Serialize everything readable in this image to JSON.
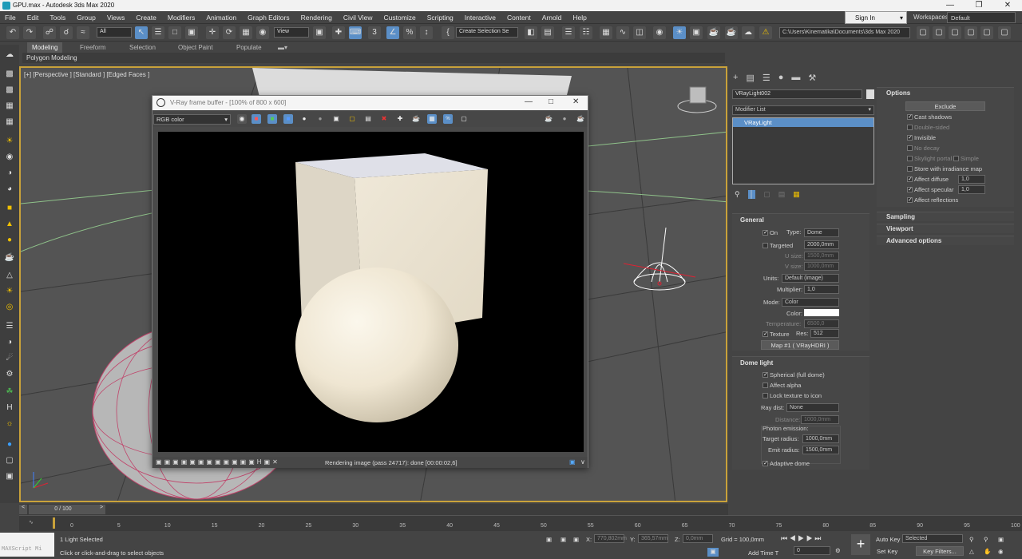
{
  "app": {
    "title": "GPU.max - Autodesk 3ds Max 2020"
  },
  "menu": [
    "File",
    "Edit",
    "Tools",
    "Group",
    "Views",
    "Create",
    "Modifiers",
    "Animation",
    "Graph Editors",
    "Rendering",
    "Civil View",
    "Customize",
    "Scripting",
    "Interactive",
    "Content",
    "Arnold",
    "Help"
  ],
  "account": {
    "signin": "Sign In",
    "workspaces_label": "Workspaces:",
    "workspace": "Default"
  },
  "toolbar": {
    "selection_filter": "All",
    "ref_coord": "View",
    "named_selection": "Create Selection Se",
    "project_path": "C:\\Users\\Kinematika\\Documents\\3ds Max 2020"
  },
  "ribbon": {
    "tabs": [
      "Modeling",
      "Freeform",
      "Selection",
      "Object Paint",
      "Populate"
    ],
    "sub": "Polygon Modeling"
  },
  "viewport": {
    "label": "[+] [Perspective ] [Standard ] [Edged Faces ]"
  },
  "vfb": {
    "title": "V-Ray frame buffer - [100% of 800 x 600]",
    "channel": "RGB color",
    "status": "Rendering image (pass 24717): done [00:00:02,6]"
  },
  "modify": {
    "object_name": "VRayLight002",
    "modifier_list": "Modifier List",
    "stack_item": "VRayLight",
    "general": {
      "title": "General",
      "on": "On",
      "type_label": "Type:",
      "type": "Dome",
      "targeted": "Targeted",
      "targeted_val": "2000,0mm",
      "usize_label": "U size:",
      "usize": "1500,0mm",
      "vsize_label": "V size:",
      "vsize": "1000,0mm",
      "units_label": "Units:",
      "units": "Default (image)",
      "multiplier_label": "Multiplier:",
      "multiplier": "1,0",
      "mode_label": "Mode:",
      "mode": "Color",
      "color_label": "Color:",
      "temperature_label": "Temperature:",
      "temperature": "6500,0",
      "texture": "Texture",
      "res_label": "Res:",
      "res": "512",
      "map": "Map #1 ( VRayHDRI )"
    },
    "dome": {
      "title": "Dome light",
      "spherical": "Spherical (full dome)",
      "affect_alpha": "Affect alpha",
      "lock": "Lock texture to icon",
      "raydist_label": "Ray dist:",
      "raydist": "None",
      "distance_label": "Distance:",
      "distance": "1000,0mm",
      "photon": "Photon emission:",
      "target_label": "Target radius:",
      "target": "1000,0mm",
      "emit_label": "Emit radius:",
      "emit": "1500,0mm",
      "adaptive": "Adaptive dome"
    },
    "options": {
      "title": "Options",
      "exclude": "Exclude",
      "cast_shadows": "Cast shadows",
      "double_sided": "Double-sided",
      "invisible": "Invisible",
      "no_decay": "No decay",
      "skylight": "Skylight portal",
      "simple": "Simple",
      "store": "Store with irradiance map",
      "affect_diffuse": "Affect diffuse",
      "affect_diffuse_val": "1,0",
      "affect_specular": "Affect specular",
      "affect_specular_val": "1,0",
      "affect_reflections": "Affect reflections"
    },
    "rollouts": [
      "Sampling",
      "Viewport",
      "Advanced options"
    ]
  },
  "timeline": {
    "frame": "0 / 100",
    "ticks": [
      "0",
      "5",
      "10",
      "15",
      "20",
      "25",
      "30",
      "35",
      "40",
      "45",
      "50",
      "55",
      "60",
      "65",
      "70",
      "75",
      "80",
      "85",
      "90",
      "95",
      "100"
    ]
  },
  "status": {
    "maxscript": "MAXScript Mi",
    "selected": "1 Light Selected",
    "prompt": "Click or click-and-drag to select objects",
    "x_label": "X:",
    "x": "770,802mm",
    "y_label": "Y:",
    "y": "365,57mm",
    "z_label": "Z:",
    "z": "0,0mm",
    "grid": "Grid = 100,0mm",
    "add_time_tag": "Add Time T",
    "frame": "0",
    "auto_key": "Auto Key",
    "set_key": "Set Key",
    "key_mode": "Selected",
    "key_filters": "Key Filters..."
  }
}
